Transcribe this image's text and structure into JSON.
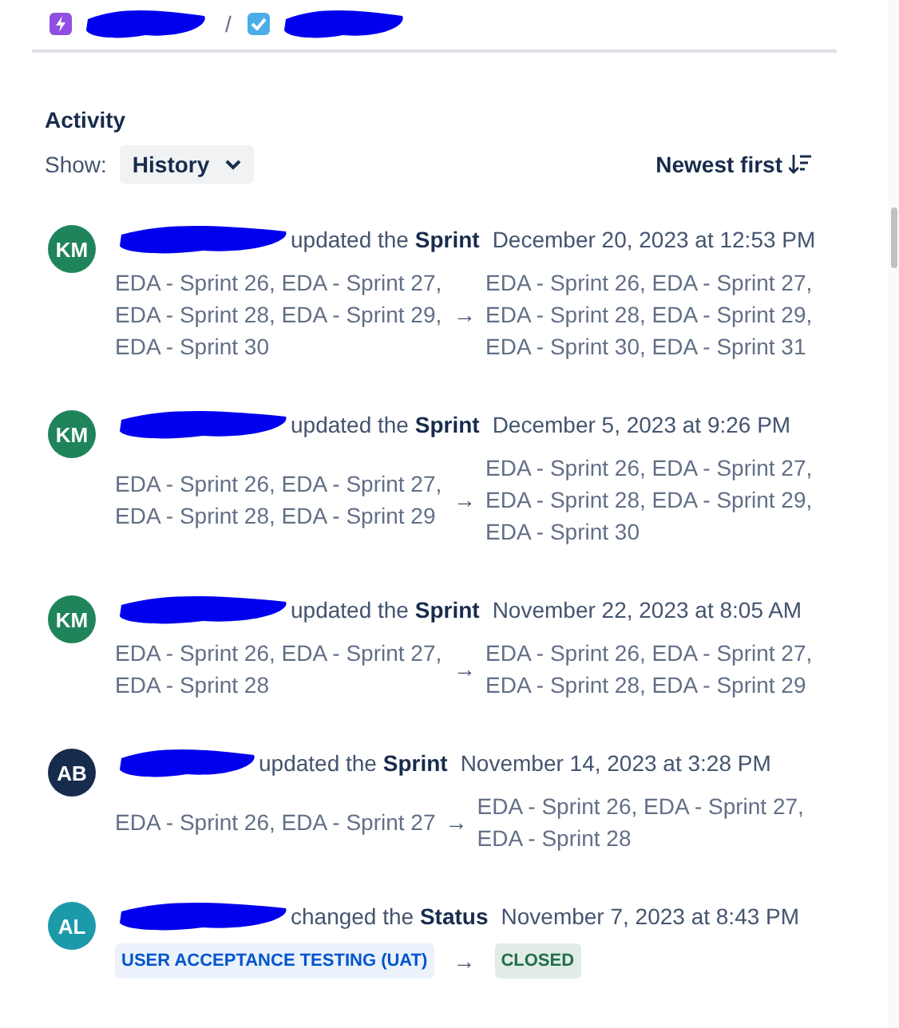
{
  "breadcrumbs": [
    {
      "kind": "epic"
    },
    {
      "kind": "task"
    }
  ],
  "breadcrumb_separator": "/",
  "activity": {
    "title": "Activity",
    "show_label": "Show:",
    "show_value": "History",
    "sort_label": "Newest first"
  },
  "entries": [
    {
      "kind": "change",
      "initials": "KM",
      "color": "#1f845a",
      "action": "updated the **Sprint**",
      "time": "December 20, 2023 at 12:53 PM",
      "from": "EDA - Sprint 26, EDA - Sprint 27, EDA - Sprint 28, EDA - Sprint 29, EDA - Sprint 30",
      "arrow": "→",
      "to": "EDA - Sprint 26, EDA - Sprint 27, EDA - Sprint 28, EDA - Sprint 29, EDA - Sprint 30, EDA - Sprint 31"
    },
    {
      "kind": "change",
      "initials": "KM",
      "color": "#1f845a",
      "action": "updated the **Sprint**",
      "time": "December 5, 2023 at 9:26 PM",
      "from": "EDA - Sprint 26, EDA - Sprint 27, EDA - Sprint 28, EDA - Sprint 29",
      "arrow": "→",
      "to": "EDA - Sprint 26, EDA - Sprint 27, EDA - Sprint 28, EDA - Sprint 29, EDA - Sprint 30"
    },
    {
      "kind": "change",
      "initials": "KM",
      "color": "#1f845a",
      "action": "updated the **Sprint**",
      "time": "November 22, 2023 at 8:05 AM",
      "from": "EDA - Sprint 26, EDA - Sprint 27, EDA - Sprint 28",
      "arrow": "→",
      "to": "EDA - Sprint 26, EDA - Sprint 27, EDA - Sprint 28, EDA - Sprint 29"
    },
    {
      "kind": "change",
      "initials": "AB",
      "color": "#172b4d",
      "action": "updated the **Sprint**",
      "time": "November 14, 2023 at 3:28 PM",
      "from": "EDA - Sprint 26, EDA - Sprint 27",
      "arrow": "→",
      "to": "EDA - Sprint 26, EDA - Sprint 27, EDA - Sprint 28"
    },
    {
      "kind": "status",
      "initials": "AL",
      "color": "#1d9aaa",
      "action": "changed the **Status**",
      "time": "November 7, 2023 at 8:43 PM",
      "from": {
        "label": "USER ACCEPTANCE TESTING (UAT)",
        "color": "#0055cc"
      },
      "arrow": "→",
      "to": {
        "label": "CLOSED",
        "color": "#216e4e"
      }
    }
  ]
}
